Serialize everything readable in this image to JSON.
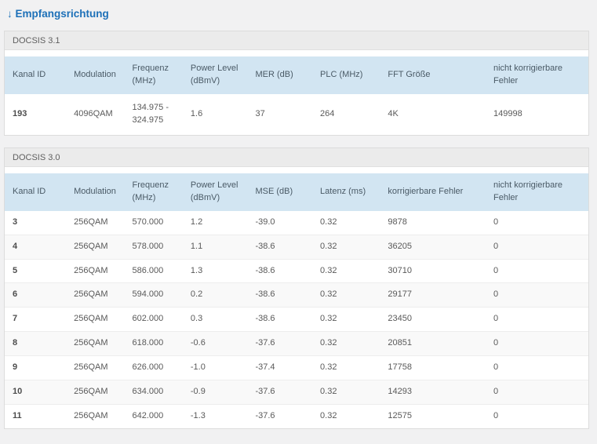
{
  "page": {
    "title": "↓ Empfangsrichtung",
    "accent_color": "#1d70b8",
    "header_row_color": "#d2e5f2",
    "section_band_color": "#ebebeb"
  },
  "tables": [
    {
      "section": "DOCSIS 3.1",
      "headers": [
        "Kanal ID",
        "Modulation",
        "Frequenz (MHz)",
        "Power Level\n(dBmV)",
        "MER (dB)",
        "PLC (MHz)",
        "FFT Größe",
        "nicht korrigierbare Fehler"
      ],
      "rows": [
        [
          "193",
          "4096QAM",
          "134.975 -\n324.975",
          "1.6",
          "37",
          "264",
          "4K",
          "149998"
        ]
      ]
    },
    {
      "section": "DOCSIS 3.0",
      "headers": [
        "Kanal ID",
        "Modulation",
        "Frequenz (MHz)",
        "Power Level\n(dBmV)",
        "MSE (dB)",
        "Latenz (ms)",
        "korrigierbare Fehler",
        "nicht korrigierbare Fehler"
      ],
      "rows": [
        [
          "3",
          "256QAM",
          "570.000",
          "1.2",
          "-39.0",
          "0.32",
          "9878",
          "0"
        ],
        [
          "4",
          "256QAM",
          "578.000",
          "1.1",
          "-38.6",
          "0.32",
          "36205",
          "0"
        ],
        [
          "5",
          "256QAM",
          "586.000",
          "1.3",
          "-38.6",
          "0.32",
          "30710",
          "0"
        ],
        [
          "6",
          "256QAM",
          "594.000",
          "0.2",
          "-38.6",
          "0.32",
          "29177",
          "0"
        ],
        [
          "7",
          "256QAM",
          "602.000",
          "0.3",
          "-38.6",
          "0.32",
          "23450",
          "0"
        ],
        [
          "8",
          "256QAM",
          "618.000",
          "-0.6",
          "-37.6",
          "0.32",
          "20851",
          "0"
        ],
        [
          "9",
          "256QAM",
          "626.000",
          "-1.0",
          "-37.4",
          "0.32",
          "17758",
          "0"
        ],
        [
          "10",
          "256QAM",
          "634.000",
          "-0.9",
          "-37.6",
          "0.32",
          "14293",
          "0"
        ],
        [
          "11",
          "256QAM",
          "642.000",
          "-1.3",
          "-37.6",
          "0.32",
          "12575",
          "0"
        ]
      ]
    }
  ]
}
